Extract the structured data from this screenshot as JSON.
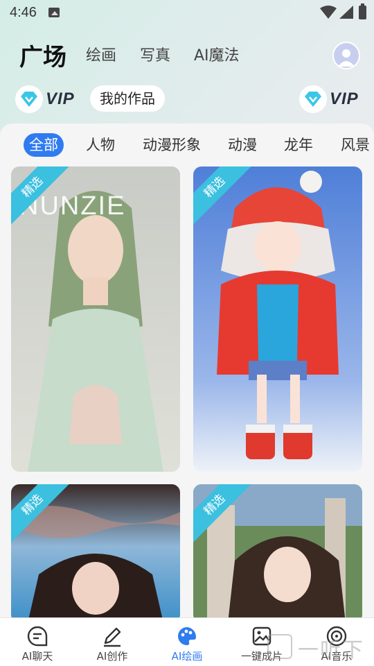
{
  "status_bar": {
    "time": "4:46"
  },
  "header": {
    "tabs": [
      {
        "label": "广场",
        "active": true
      },
      {
        "label": "绘画"
      },
      {
        "label": "写真"
      },
      {
        "label": "AI魔法"
      }
    ]
  },
  "vip": {
    "left_label": "VIP",
    "right_label": "VIP",
    "my_works": "我的作品"
  },
  "categories": [
    "全部",
    "人物",
    "动漫形象",
    "动漫",
    "龙年",
    "风景"
  ],
  "active_category": "全部",
  "gallery": [
    {
      "badge": "精选",
      "overlay_text": "NUNZIE"
    },
    {
      "badge": "精选"
    },
    {
      "badge": "精选"
    },
    {
      "badge": "精选"
    }
  ],
  "bottom_nav": [
    {
      "label": "AI聊天",
      "icon": "chat-icon"
    },
    {
      "label": "AI创作",
      "icon": "pencil-icon"
    },
    {
      "label": "AI绘画",
      "icon": "palette-icon",
      "active": true
    },
    {
      "label": "一键成片",
      "icon": "image-icon"
    },
    {
      "label": "AI音乐",
      "icon": "music-disc-icon"
    }
  ],
  "watermark": "一听下载",
  "colors": {
    "accent": "#2f7bf0",
    "badge": "#3bc0e0"
  }
}
